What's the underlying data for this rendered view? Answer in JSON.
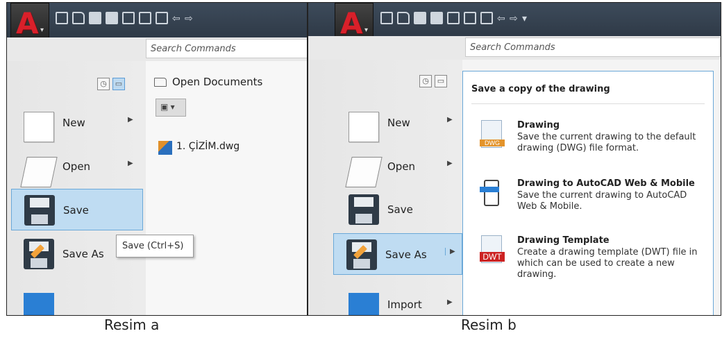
{
  "captions": {
    "a": "Resim a",
    "b": "Resim b"
  },
  "app": {
    "logo_letter": "A",
    "search_placeholder": "Search Commands"
  },
  "menu": {
    "new": "New",
    "open": "Open",
    "save": "Save",
    "save_as": "Save As",
    "import": "Import"
  },
  "tooltip": "Save (Ctrl+S)",
  "open_documents": {
    "title": "Open Documents",
    "files": [
      "1. ÇİZİM.dwg"
    ]
  },
  "save_as_flyout": {
    "title": "Save a copy of the drawing",
    "options": [
      {
        "name": "Drawing",
        "desc": "Save the current drawing to the default drawing (DWG) file format.",
        "badge": "DWG"
      },
      {
        "name": "Drawing to AutoCAD Web & Mobile",
        "desc": "Save the current drawing to AutoCAD Web & Mobile."
      },
      {
        "name": "Drawing Template",
        "desc": "Create a drawing template (DWT) file in which can be used to create a new drawing.",
        "badge": "DWT"
      }
    ]
  },
  "colors": {
    "accent_red": "#d9202a",
    "selection_blue": "#bfdcf2",
    "titlebar": "#34414f"
  }
}
